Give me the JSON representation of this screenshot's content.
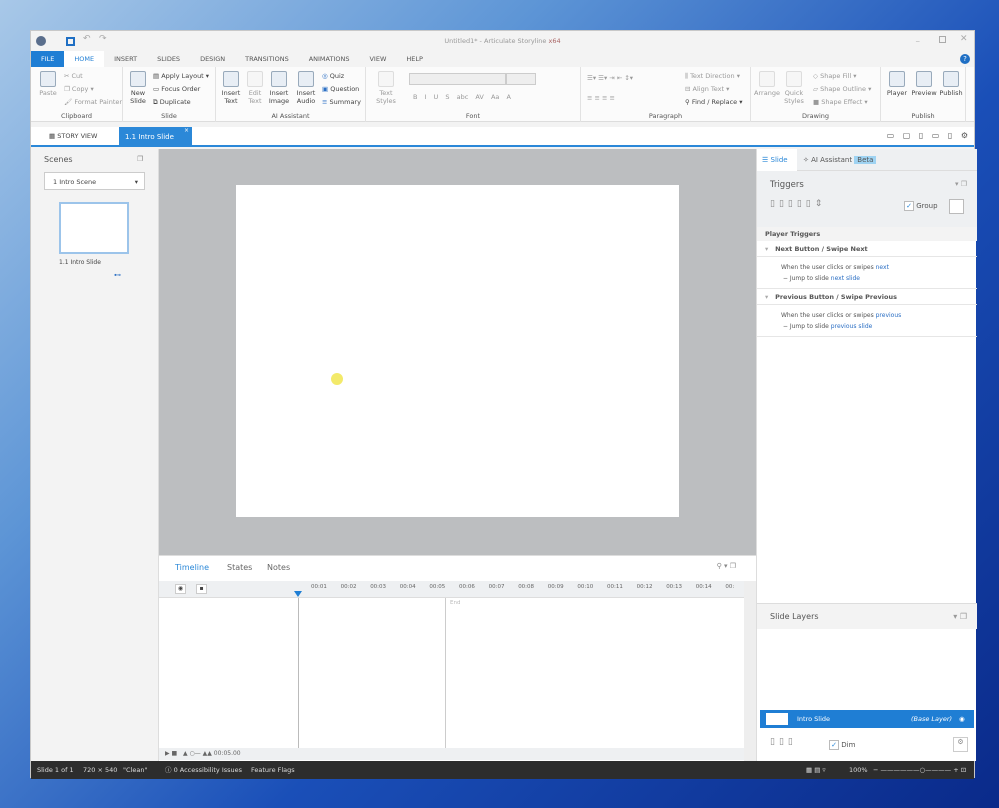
{
  "window": {
    "title": "Untitled1* - Articulate Storyline",
    "arch": "x64"
  },
  "tabs": [
    "FILE",
    "HOME",
    "INSERT",
    "SLIDES",
    "DESIGN",
    "TRANSITIONS",
    "ANIMATIONS",
    "VIEW",
    "HELP"
  ],
  "ribbon": {
    "clipboard": {
      "label": "Clipboard",
      "paste": "Paste",
      "cut": "Cut",
      "copy": "Copy",
      "format_painter": "Format Painter"
    },
    "slide": {
      "label": "Slide",
      "new_slide": "New Slide",
      "apply_layout": "Apply Layout",
      "focus_order": "Focus Order",
      "duplicate": "Duplicate"
    },
    "ai": {
      "label": "AI Assistant",
      "insert_text": "Insert Text",
      "edit_text": "Edit Text",
      "insert_image": "Insert Image",
      "insert_audio": "Insert Audio",
      "quiz": "Quiz",
      "question": "Question",
      "summary": "Summary"
    },
    "font": {
      "label": "Font",
      "text_styles": "Text Styles",
      "bold": "B",
      "italic": "I",
      "underline": "U",
      "strike": "S",
      "abc": "abc",
      "av": "AV",
      "aa": "Aa",
      "a": "A"
    },
    "paragraph": {
      "label": "Paragraph",
      "text_direction": "Text Direction",
      "align_text": "Align Text",
      "find_replace": "Find / Replace"
    },
    "drawing": {
      "label": "Drawing",
      "arrange": "Arrange",
      "quick_styles": "Quick Styles",
      "shape_fill": "Shape Fill",
      "shape_outline": "Shape Outline",
      "shape_effect": "Shape Effect"
    },
    "publish": {
      "label": "Publish",
      "player": "Player",
      "preview": "Preview",
      "publish": "Publish"
    }
  },
  "doc_tabs": {
    "story_view": "STORY VIEW",
    "current": "1.1 Intro Slide"
  },
  "scenes": {
    "title": "Scenes",
    "selected": "1 Intro Scene",
    "thumb_label": "1.1 Intro Slide"
  },
  "timeline": {
    "tabs": [
      "Timeline",
      "States",
      "Notes"
    ],
    "ticks": [
      "00:01",
      "00:02",
      "00:03",
      "00:04",
      "00:05",
      "00:06",
      "00:07",
      "00:08",
      "00:09",
      "00:10",
      "00:11",
      "00:12",
      "00:13",
      "00:14",
      "00:"
    ],
    "end_label": "End",
    "duration": "00:05.00"
  },
  "right": {
    "tab_slide": "Slide",
    "tab_ai": "AI Assistant",
    "beta": "Beta",
    "triggers_title": "Triggers",
    "group": "Group",
    "player_triggers": "Player Triggers",
    "triggers": [
      {
        "title": "Next Button / Swipe Next",
        "when": "When the user clicks or swipes",
        "when_link": "next",
        "action": "Jump to slide",
        "action_link": "next slide"
      },
      {
        "title": "Previous Button / Swipe Previous",
        "when": "When the user clicks or swipes",
        "when_link": "previous",
        "action": "Jump to slide",
        "action_link": "previous slide"
      }
    ],
    "layers_title": "Slide Layers",
    "layer_name": "Intro Slide",
    "layer_tag": "(Base Layer)",
    "dim": "Dim"
  },
  "status": {
    "slide": "Slide 1 of 1",
    "size": "720 × 540",
    "theme": "\"Clean\"",
    "accessibility": "0 Accessibility Issues",
    "flags": "Feature Flags",
    "zoom": "100%"
  }
}
